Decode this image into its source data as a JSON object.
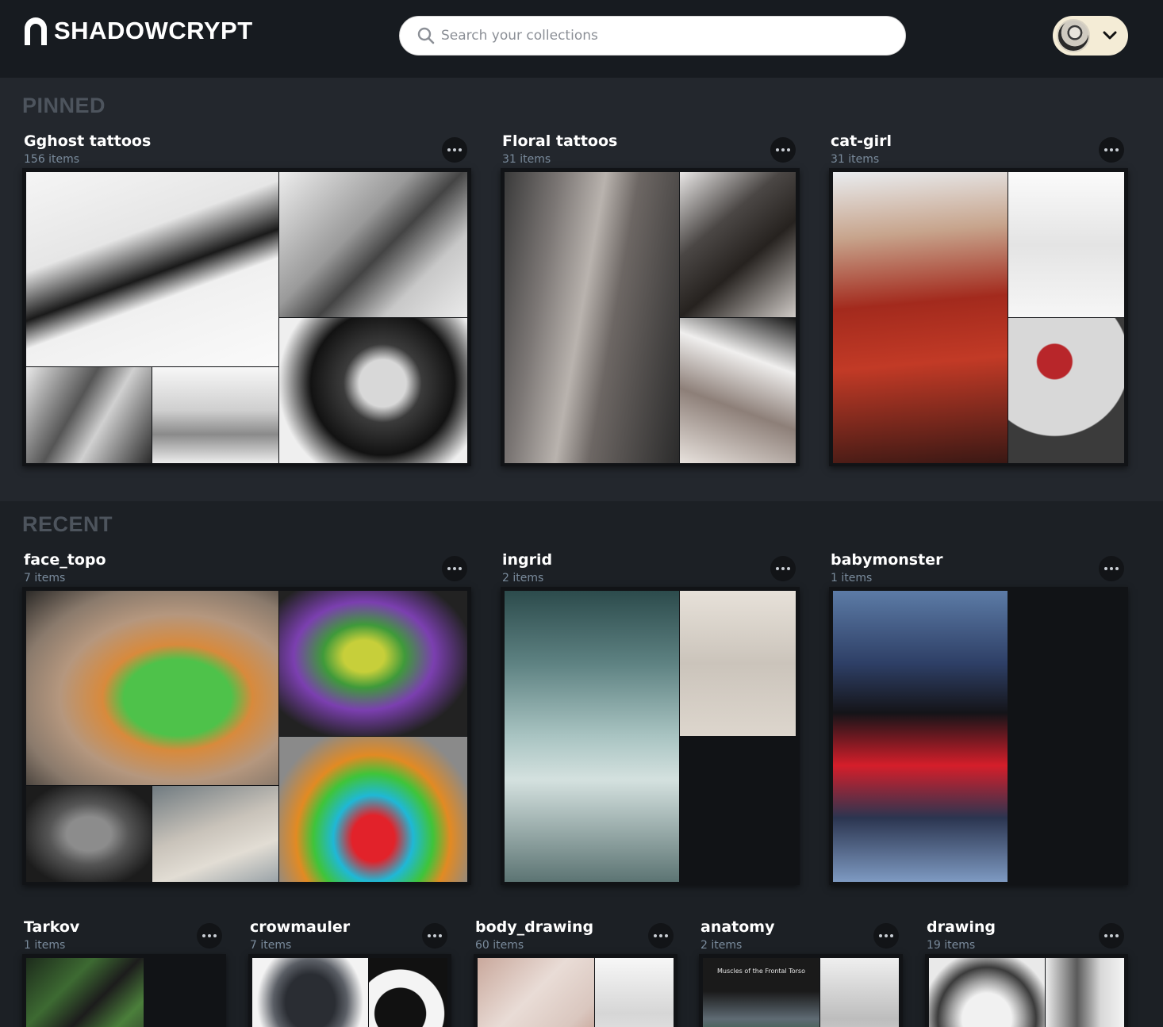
{
  "app": {
    "name": "SHADOWCRYPT"
  },
  "search": {
    "placeholder": "Search your collections",
    "value": ""
  },
  "sections": {
    "pinned": "PINNED",
    "recent": "RECENT"
  },
  "collections": {
    "ghost": {
      "name": "Gghost tattoos",
      "count": "156 items"
    },
    "floral": {
      "name": "Floral tattoos",
      "count": "31 items"
    },
    "catgirl": {
      "name": "cat-girl",
      "count": "31 items"
    },
    "facetopo": {
      "name": "face_topo",
      "count": "7 items"
    },
    "ingrid": {
      "name": "ingrid",
      "count": "2 items"
    },
    "babymonster": {
      "name": "babymonster",
      "count": "1 items"
    },
    "tarkov": {
      "name": "Tarkov",
      "count": "1 items"
    },
    "crowmauler": {
      "name": "crowmauler",
      "count": "7 items"
    },
    "bodydrawing": {
      "name": "body_drawing",
      "count": "60 items"
    },
    "anatomy": {
      "name": "anatomy",
      "count": "2 items"
    },
    "drawing": {
      "name": "drawing",
      "count": "19 items"
    }
  },
  "anatomy_thumb_text": "Muscles of the Frontal Torso",
  "colors": {
    "header_bg": "#171b20",
    "pinned_bg": "#23272d",
    "recent_bg": "#1c2025",
    "section_title": "#4d545d",
    "item_count": "#7a8b9c",
    "account_pill": "#f4ecd6"
  }
}
